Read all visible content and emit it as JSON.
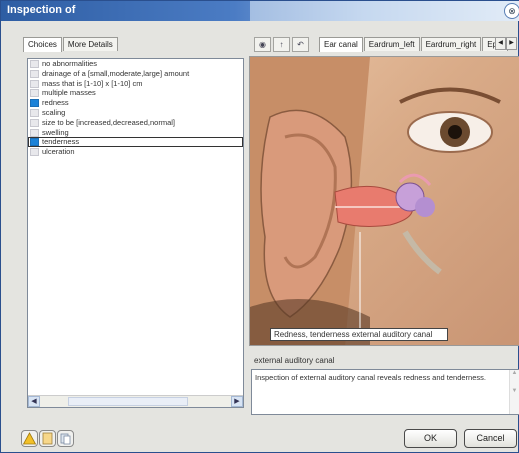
{
  "window": {
    "title": "Inspection of",
    "close_glyph": "⊗"
  },
  "left_tabs": [
    "Choices",
    "More Details"
  ],
  "choices": [
    {
      "label": "no abnormalities",
      "checked": false
    },
    {
      "label": "drainage of a [small,moderate,large] amount",
      "checked": false
    },
    {
      "label": "mass that is [1-10] x [1-10] cm",
      "checked": false
    },
    {
      "label": "multiple masses",
      "checked": false
    },
    {
      "label": "redness",
      "checked": true
    },
    {
      "label": "scaling",
      "checked": false
    },
    {
      "label": "size to be [increased,decreased,normal]",
      "checked": false
    },
    {
      "label": "swelling",
      "checked": false
    },
    {
      "label": "tenderness",
      "checked": true,
      "focused": true
    },
    {
      "label": "ulceration",
      "checked": false
    }
  ],
  "right_tabs": [
    "Ear canal",
    "Eardrum_left",
    "Eardrum_right",
    "Epic"
  ],
  "image_caption": "Redness, tenderness external auditory canal",
  "structure_label": "external auditory canal",
  "description": "Inspection of external auditory canal reveals redness and tenderness.",
  "buttons": {
    "ok": "OK",
    "cancel": "Cancel"
  },
  "icons": {
    "toolbar": [
      "globe-icon",
      "arrow-up-icon",
      "back-icon"
    ],
    "bottom": [
      "warning-icon",
      "notes-icon",
      "copy-icon"
    ]
  },
  "colors": {
    "checked": "#1c82d8",
    "title_bar": "#2e5da3"
  }
}
